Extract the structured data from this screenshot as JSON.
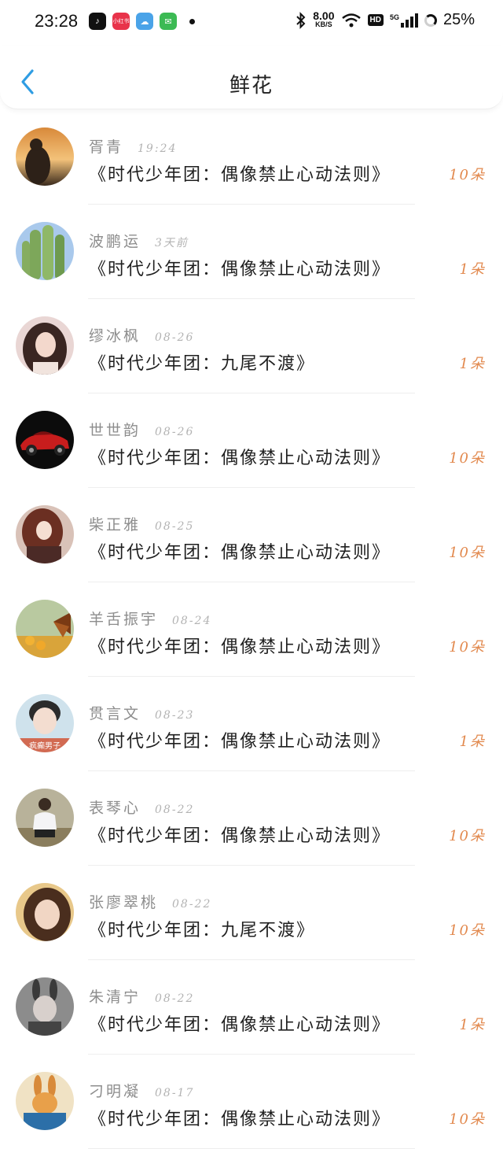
{
  "status_bar": {
    "time": "23:28",
    "apps": [
      {
        "icon": "tiktok-icon",
        "color": "#111111",
        "glyph": "♪"
      },
      {
        "icon": "xiaohongshu-icon",
        "color": "#e8334a",
        "glyph": "小红书"
      },
      {
        "icon": "weather-icon",
        "color": "#4aa3e8",
        "glyph": "☁"
      },
      {
        "icon": "shopping-icon",
        "color": "#3cba54",
        "glyph": "✉"
      }
    ],
    "net_speed": "8.00",
    "net_unit": "KB/S",
    "hd_label": "HD",
    "signal_label": "5G",
    "battery": "25%"
  },
  "header": {
    "title": "鲜花",
    "back_icon": "chevron-left-icon",
    "accent": "#2f9de3"
  },
  "colors": {
    "count": "#e2894e",
    "name": "#8d8d8d",
    "time": "#b3b3b3",
    "book": "#1f1f1f"
  },
  "items": [
    {
      "name": "胥青",
      "time": "19:24",
      "book": "《时代少年团：偶像禁止心动法则》",
      "count": "10朵",
      "avatar": "sunset-silhouette"
    },
    {
      "name": "波鹏运",
      "time": "3天前",
      "book": "《时代少年团：偶像禁止心动法则》",
      "count": "1朵",
      "avatar": "cactus"
    },
    {
      "name": "缪冰枫",
      "time": "08-26",
      "book": "《时代少年团：九尾不渡》",
      "count": "1朵",
      "avatar": "girl-portrait"
    },
    {
      "name": "世世韵",
      "time": "08-26",
      "book": "《时代少年团：偶像禁止心动法则》",
      "count": "10朵",
      "avatar": "red-sports-car"
    },
    {
      "name": "柴正雅",
      "time": "08-25",
      "book": "《时代少年团：偶像禁止心动法则》",
      "count": "10朵",
      "avatar": "anime-girl"
    },
    {
      "name": "羊舌振宇",
      "time": "08-24",
      "book": "《时代少年团：偶像禁止心动法则》",
      "count": "10朵",
      "avatar": "butterfly-flowers"
    },
    {
      "name": "贯言文",
      "time": "08-23",
      "book": "《时代少年团：偶像禁止心动法则》",
      "count": "1朵",
      "avatar": "boy-portrait",
      "avatar_caption": "疯癫男子"
    },
    {
      "name": "表琴心",
      "time": "08-22",
      "book": "《时代少年团：偶像禁止心动法则》",
      "count": "10朵",
      "avatar": "man-squatting"
    },
    {
      "name": "张廖翠桃",
      "time": "08-22",
      "book": "《时代少年团：九尾不渡》",
      "count": "10朵",
      "avatar": "woman-selfie"
    },
    {
      "name": "朱清宁",
      "time": "08-22",
      "book": "《时代少年团：偶像禁止心动法则》",
      "count": "1朵",
      "avatar": "bunny-ears"
    },
    {
      "name": "刁明凝",
      "time": "08-17",
      "book": "《时代少年团：偶像禁止心动法则》",
      "count": "10朵",
      "avatar": "cartoon-rabbit"
    }
  ]
}
